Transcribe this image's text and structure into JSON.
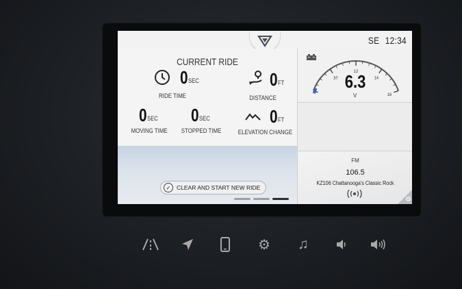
{
  "header": {
    "compass": "SE",
    "time": "12:34"
  },
  "current_ride": {
    "title": "CURRENT RIDE",
    "ride_time": {
      "value": "0",
      "unit": "SEC",
      "label": "RIDE TIME"
    },
    "distance": {
      "value": "0",
      "unit": "FT",
      "label": "DISTANCE"
    },
    "moving_time": {
      "value": "0",
      "unit": "SEC",
      "label": "MOVING TIME"
    },
    "stopped_time": {
      "value": "0",
      "unit": "SEC",
      "label": "STOPPED TIME"
    },
    "elevation_change": {
      "value": "0",
      "unit": "FT",
      "label": "ELEVATION CHANGE"
    },
    "clear_button_label": "CLEAR AND START NEW RIDE",
    "pages": 3,
    "active_page": 3
  },
  "voltmeter": {
    "value": "6.3",
    "unit": "V",
    "ticks": [
      "10",
      "12",
      "14",
      "16"
    ],
    "min": 8,
    "max": 16
  },
  "radio": {
    "band": "FM",
    "frequency": "106.5",
    "station": "KZ106 Chattanooga's Classic Rock"
  },
  "hardware_buttons": [
    "navigation-road-icon",
    "location-arrow-icon",
    "phone-icon",
    "settings-gear-icon",
    "music-note-icon",
    "volume-down-icon",
    "volume-up-icon"
  ],
  "colors": {
    "accent_blue": "#3a67b5",
    "screen_bg": "#f4f4f4",
    "bezel": "#0a0b0d"
  }
}
